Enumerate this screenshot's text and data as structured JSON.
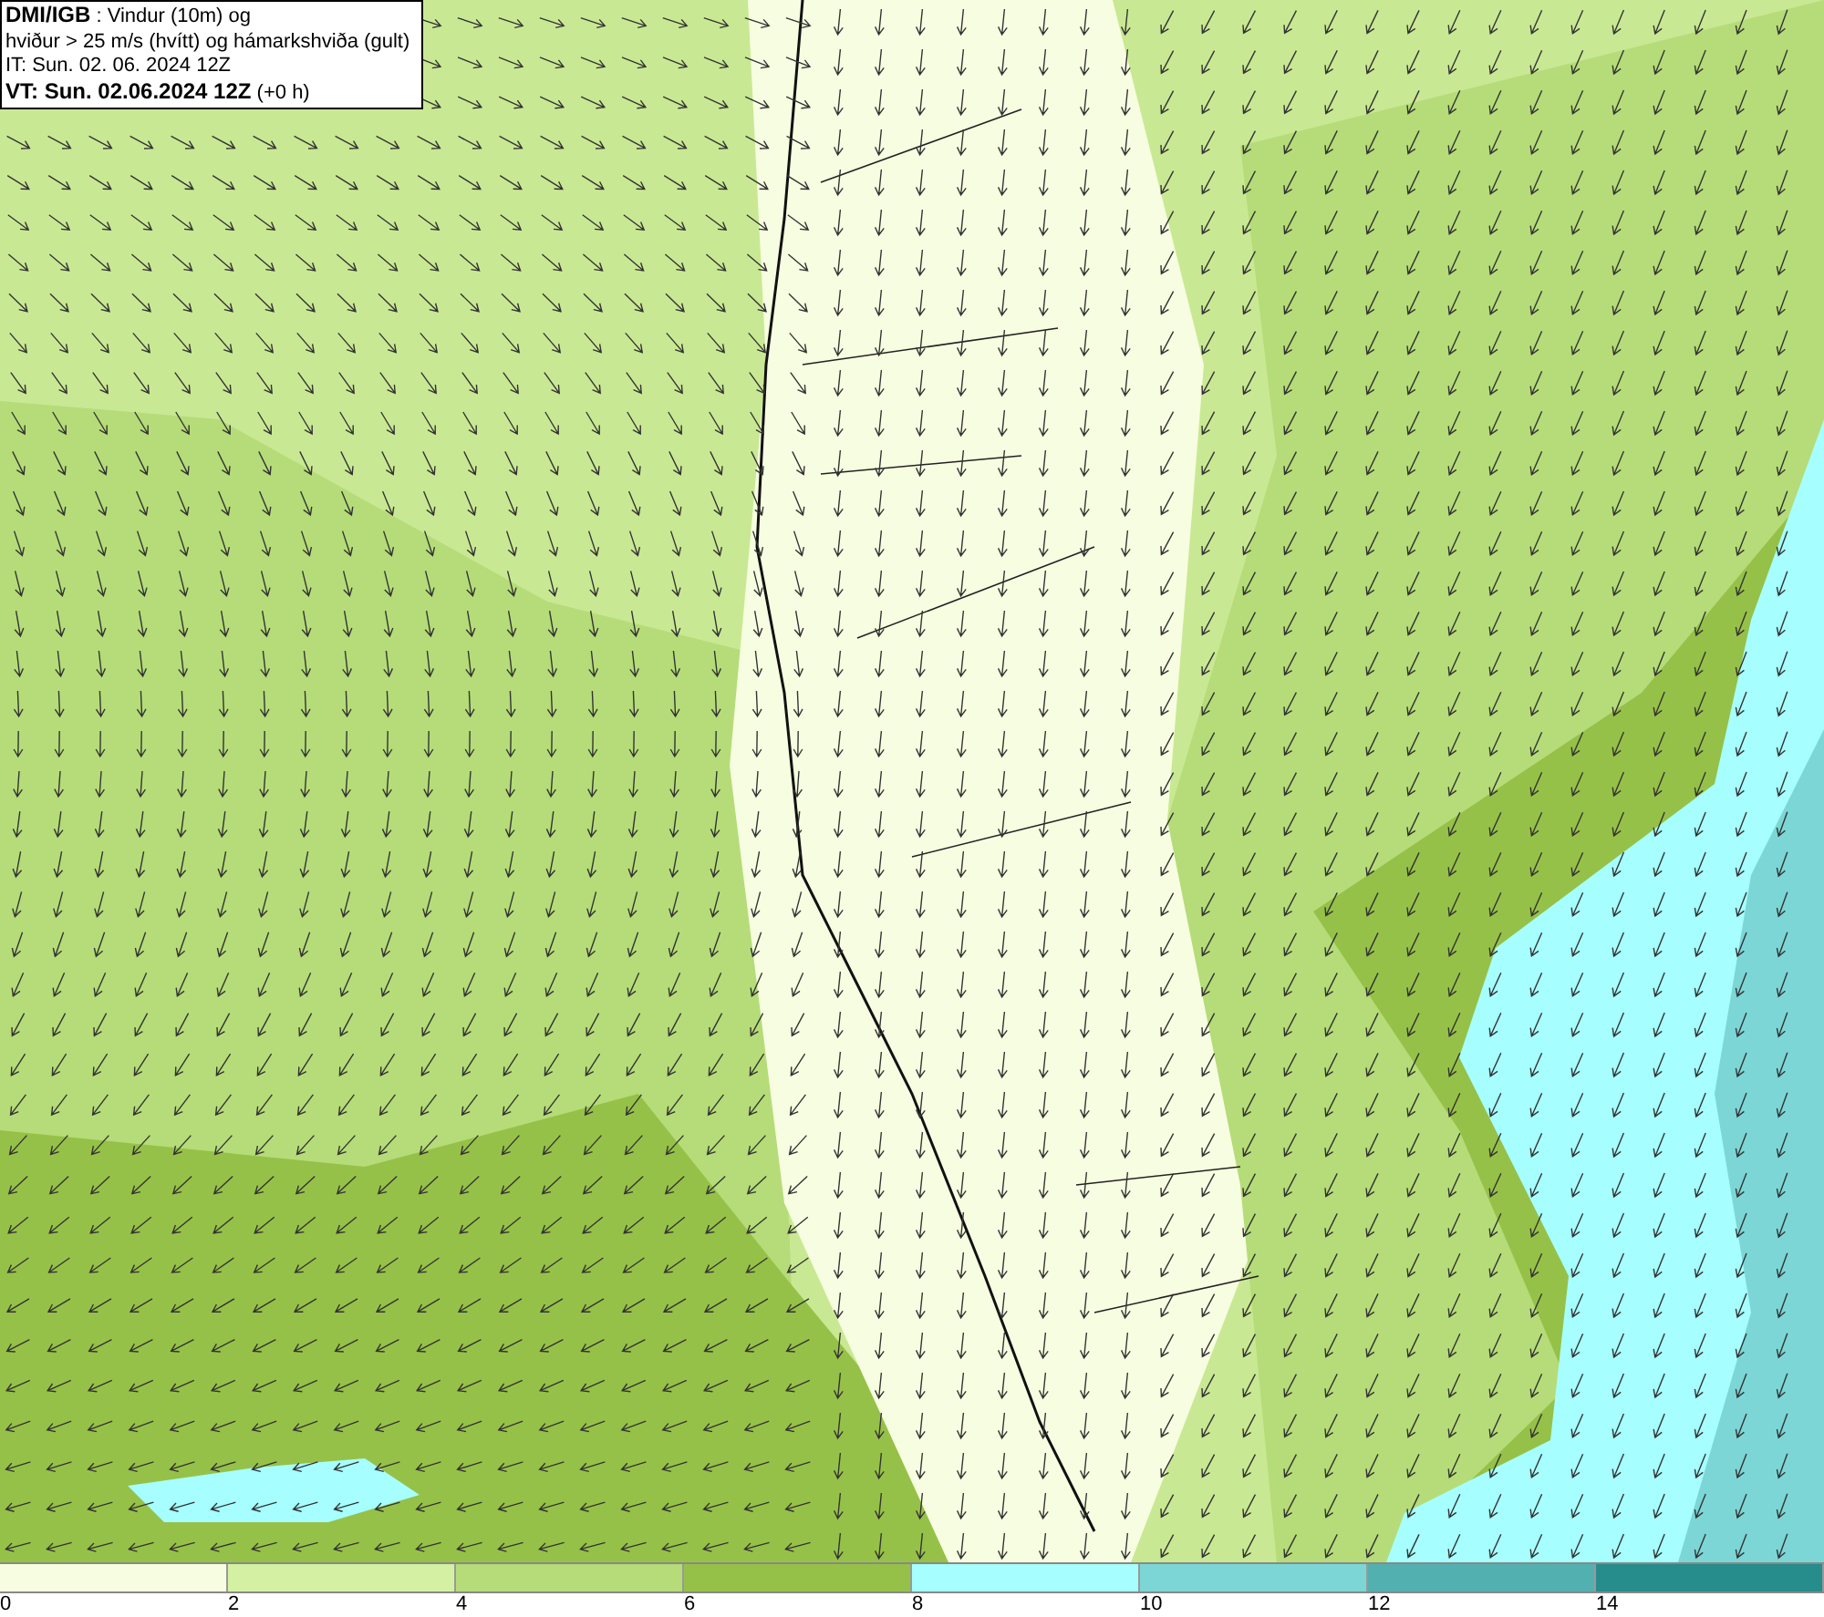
{
  "title_box": {
    "lines": [
      "**DMI/IGB** : Vindur (10m) og",
      "hviður > 25 m/s (hvítt) og hámarkshviða (gult)",
      "IT: Sun. 02. 06. 2024 12Z",
      "**VT: Sun. 02.06.2024 12Z** (+0 h)"
    ]
  },
  "legend": {
    "bins": [
      {
        "color": "#f7fde0",
        "tick": "0"
      },
      {
        "color": "#d4f0a2",
        "tick": "2"
      },
      {
        "color": "#b5dc78",
        "tick": "4"
      },
      {
        "color": "#96c148",
        "tick": "6"
      },
      {
        "color": "#a6fefe",
        "tick": "8"
      },
      {
        "color": "#7cd6d6",
        "tick": "10"
      },
      {
        "color": "#52b0b0",
        "tick": "12"
      },
      {
        "color": "#268c8c",
        "tick": "14"
      }
    ]
  }
}
